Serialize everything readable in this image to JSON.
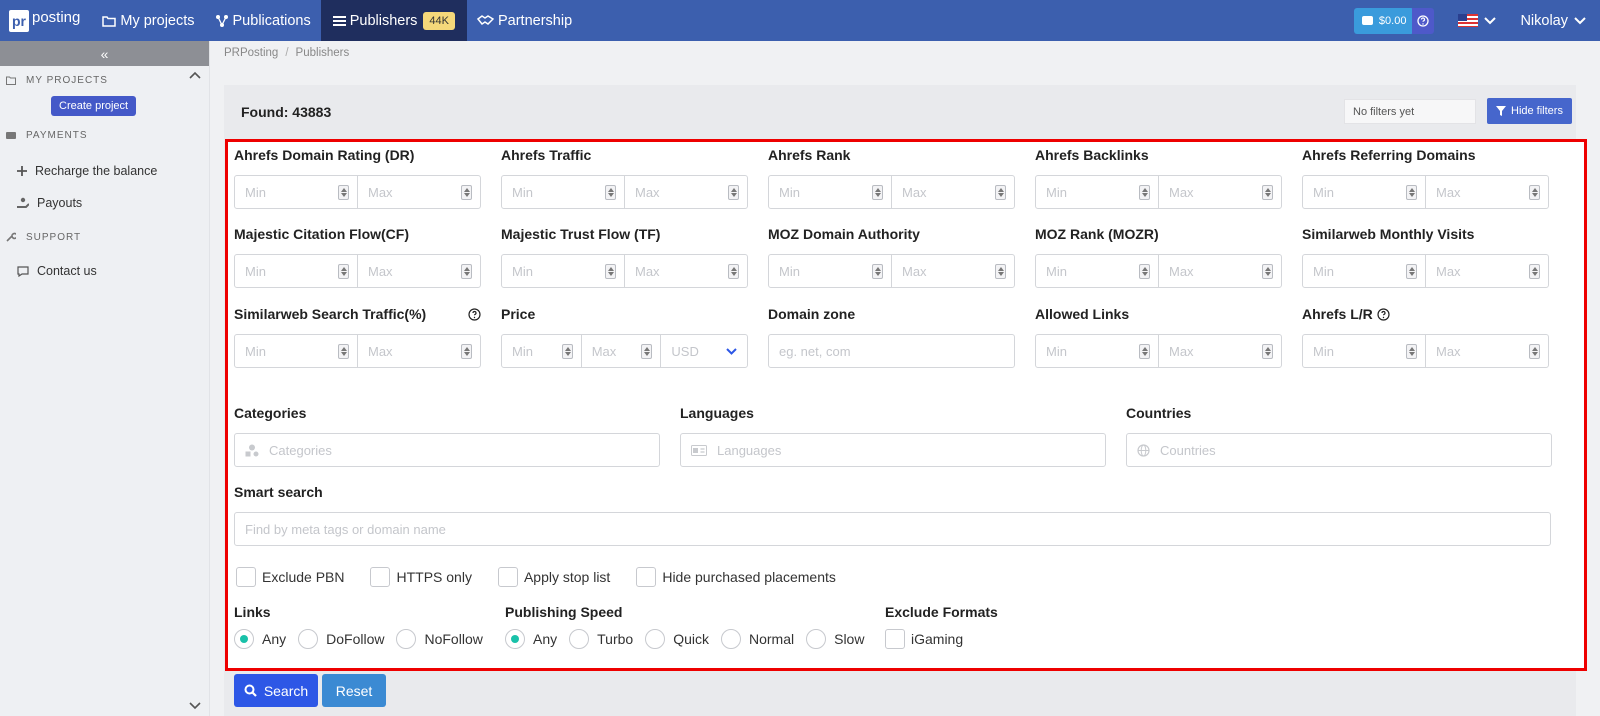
{
  "brand": {
    "logo_mark": "pr",
    "logo_text": "posting"
  },
  "nav": {
    "my_projects": "My projects",
    "publications": "Publications",
    "publishers": "Publishers",
    "publishers_badge": "44K",
    "partnership": "Partnership"
  },
  "header_right": {
    "balance": "$0.00",
    "user": "Nikolay"
  },
  "sidebar": {
    "collapse_glyph": "«",
    "my_projects_title": "MY PROJECTS",
    "create_project": "Create project",
    "payments_title": "PAYMENTS",
    "recharge": "Recharge the balance",
    "payouts": "Payouts",
    "support_title": "SUPPORT",
    "contact": "Contact us"
  },
  "breadcrumb": {
    "root": "PRPosting",
    "separator": "/",
    "current": "Publishers"
  },
  "panel": {
    "found": "Found: 43883",
    "no_filters": "No filters yet",
    "hide_filters": "Hide filters"
  },
  "placeholders": {
    "min": "Min",
    "max": "Max"
  },
  "filters": {
    "ahrefs_dr": "Ahrefs Domain Rating (DR)",
    "ahrefs_traffic": "Ahrefs Traffic",
    "ahrefs_rank": "Ahrefs Rank",
    "ahrefs_backlinks": "Ahrefs Backlinks",
    "ahrefs_ref_domains": "Ahrefs Referring Domains",
    "majestic_cf": "Majestic Citation Flow(CF)",
    "majestic_tf": "Majestic Trust Flow (TF)",
    "moz_da": "MOZ Domain Authority",
    "moz_rank": "MOZ Rank (MOZR)",
    "similarweb_visits": "Similarweb Monthly Visits",
    "similarweb_search": "Similarweb Search Traffic(%)",
    "price": "Price",
    "currency": "USD",
    "domain_zone": "Domain zone",
    "domain_zone_placeholder": "eg. net, com",
    "allowed_links": "Allowed Links",
    "ahrefs_lr": "Ahrefs L/R",
    "categories": "Categories",
    "categories_placeholder": "Categories",
    "languages": "Languages",
    "languages_placeholder": "Languages",
    "countries": "Countries",
    "countries_placeholder": "Countries",
    "smart_search": "Smart search",
    "smart_search_placeholder": "Find by meta tags or domain name"
  },
  "checkboxes": [
    "Exclude PBN",
    "HTTPS only",
    "Apply stop list",
    "Hide purchased placements"
  ],
  "links": {
    "label": "Links",
    "options": [
      "Any",
      "DoFollow",
      "NoFollow"
    ],
    "selected": "Any"
  },
  "speed": {
    "label": "Publishing Speed",
    "options": [
      "Any",
      "Turbo",
      "Quick",
      "Normal",
      "Slow"
    ],
    "selected": "Any"
  },
  "exclude_formats": {
    "label": "Exclude Formats",
    "options": [
      "iGaming"
    ]
  },
  "buttons": {
    "search": "Search",
    "reset": "Reset"
  },
  "colors": {
    "topbar": "#3c5fae",
    "active_nav": "#1f2e5e",
    "highlight_border": "#ee0000",
    "radio_on": "#19c1a9",
    "search_button": "#2d57e6",
    "reset_button": "#3b8ad3"
  }
}
